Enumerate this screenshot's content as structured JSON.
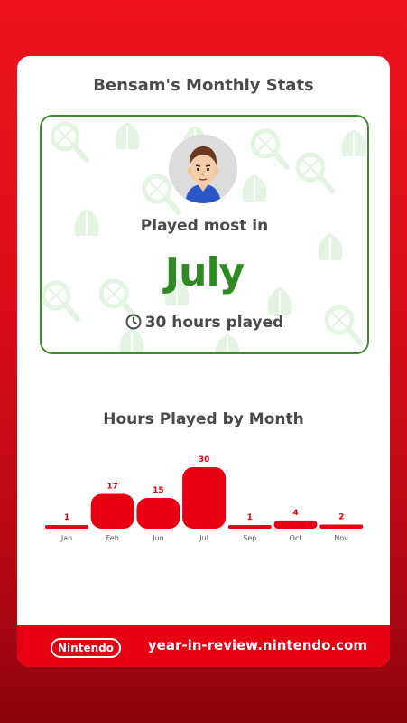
{
  "card": {
    "title": "Bensam's Monthly Stats"
  },
  "highlight": {
    "label": "Played most in",
    "month": "July",
    "hours_text": "30 hours played"
  },
  "icons": {
    "clock": "clock-icon",
    "avatar": "mii-avatar"
  },
  "chart_title": "Hours Played by Month",
  "chart_data": {
    "type": "bar",
    "categories": [
      "Jan",
      "Feb",
      "Jun",
      "Jul",
      "Sep",
      "Oct",
      "Nov"
    ],
    "values": [
      1,
      17,
      15,
      30,
      1,
      4,
      2
    ],
    "ylim": [
      0,
      30
    ],
    "grid": false,
    "colors": {
      "bar": "#e60012",
      "value_label": "#e60012",
      "tick_label": "#555555"
    }
  },
  "footer": {
    "logo_text": "Nintendo",
    "site": "year-in-review.nintendo.com"
  },
  "colors": {
    "background": "#e60012",
    "accent_green": "#2e8b22",
    "panel_border": "#3e8e2e"
  }
}
